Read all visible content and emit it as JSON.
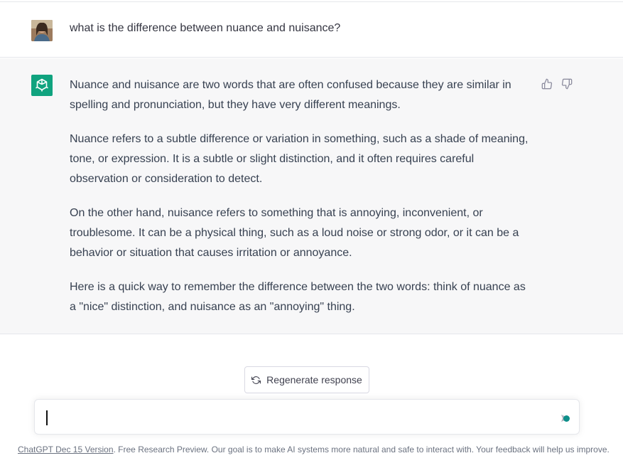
{
  "user_message": {
    "avatar": "user-avatar-photo",
    "text": "what is the difference between nuance and nuisance?"
  },
  "assistant_message": {
    "avatar": "openai-logo-icon",
    "paragraphs": [
      "Nuance and nuisance are two words that are often confused because they are similar in spelling and pronunciation, but they have very different meanings.",
      "Nuance refers to a subtle difference or variation in something, such as a shade of meaning, tone, or expression. It is a subtle or slight distinction, and it often requires careful observation or consideration to detect.",
      "On the other hand, nuisance refers to something that is annoying, inconvenient, or troublesome. It can be a physical thing, such as a loud noise or strong odor, or it can be a behavior or situation that causes irritation or annoyance.",
      "Here is a quick way to remember the difference between the two words: think of nuance as a \"nice\" distinction, and nuisance as an \"annoying\" thing."
    ],
    "feedback_icons": [
      "thumbs-up-icon",
      "thumbs-down-icon"
    ]
  },
  "regenerate": {
    "icon": "refresh-icon",
    "label": "Regenerate response"
  },
  "composer": {
    "value": "",
    "send_icon": "send-icon"
  },
  "footer": {
    "link_text": "ChatGPT Dec 15 Version",
    "text": ". Free Research Preview. Our goal is to make AI systems more natural and safe to interact with. Your feedback will help us improve."
  },
  "colors": {
    "brand": "#10a37f",
    "assistant_bg": "#f7f7f8",
    "text": "#374151",
    "border": "#e5e7eb"
  }
}
